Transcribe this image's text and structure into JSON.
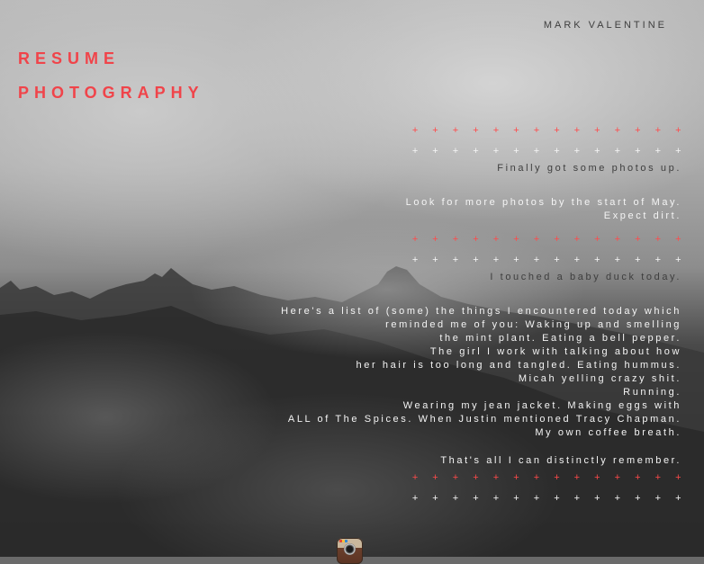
{
  "header": {
    "author": "MARK VALENTINE"
  },
  "nav": {
    "items": [
      {
        "label": "RESUME"
      },
      {
        "label": "PHOTOGRAPHY"
      }
    ]
  },
  "separator": {
    "plus_row": "+ + + + + + + + + + + + + +",
    "plus_row_white": "+ + + + + + + + + + + + + +"
  },
  "posts": [
    {
      "lines": [
        "Finally got some photos up."
      ]
    },
    {
      "lines": [
        "Look for more photos by the start of May.",
        "Expect dirt."
      ]
    },
    {
      "lines": [
        "I touched a baby duck today."
      ]
    },
    {
      "lines": [
        "Here's a list of (some) the things I encountered today which",
        "reminded me of you: Waking up and smelling",
        "the mint plant. Eating a bell pepper.",
        "The girl I work with talking about how",
        "her hair is too long and tangled. Eating hummus.",
        "Micah yelling crazy shit.",
        "Running.",
        "Wearing my jean jacket. Making eggs with",
        "ALL of The Spices. When Justin mentioned Tracy Chapman.",
        "My own coffee breath."
      ],
      "closing": "That's all I can distinctly remember."
    }
  ],
  "footer": {
    "icon": "instagram-icon"
  },
  "colors": {
    "accent": "#f0444a",
    "text_dark": "#3e3e3e",
    "text_light": "#f4f4f4"
  }
}
